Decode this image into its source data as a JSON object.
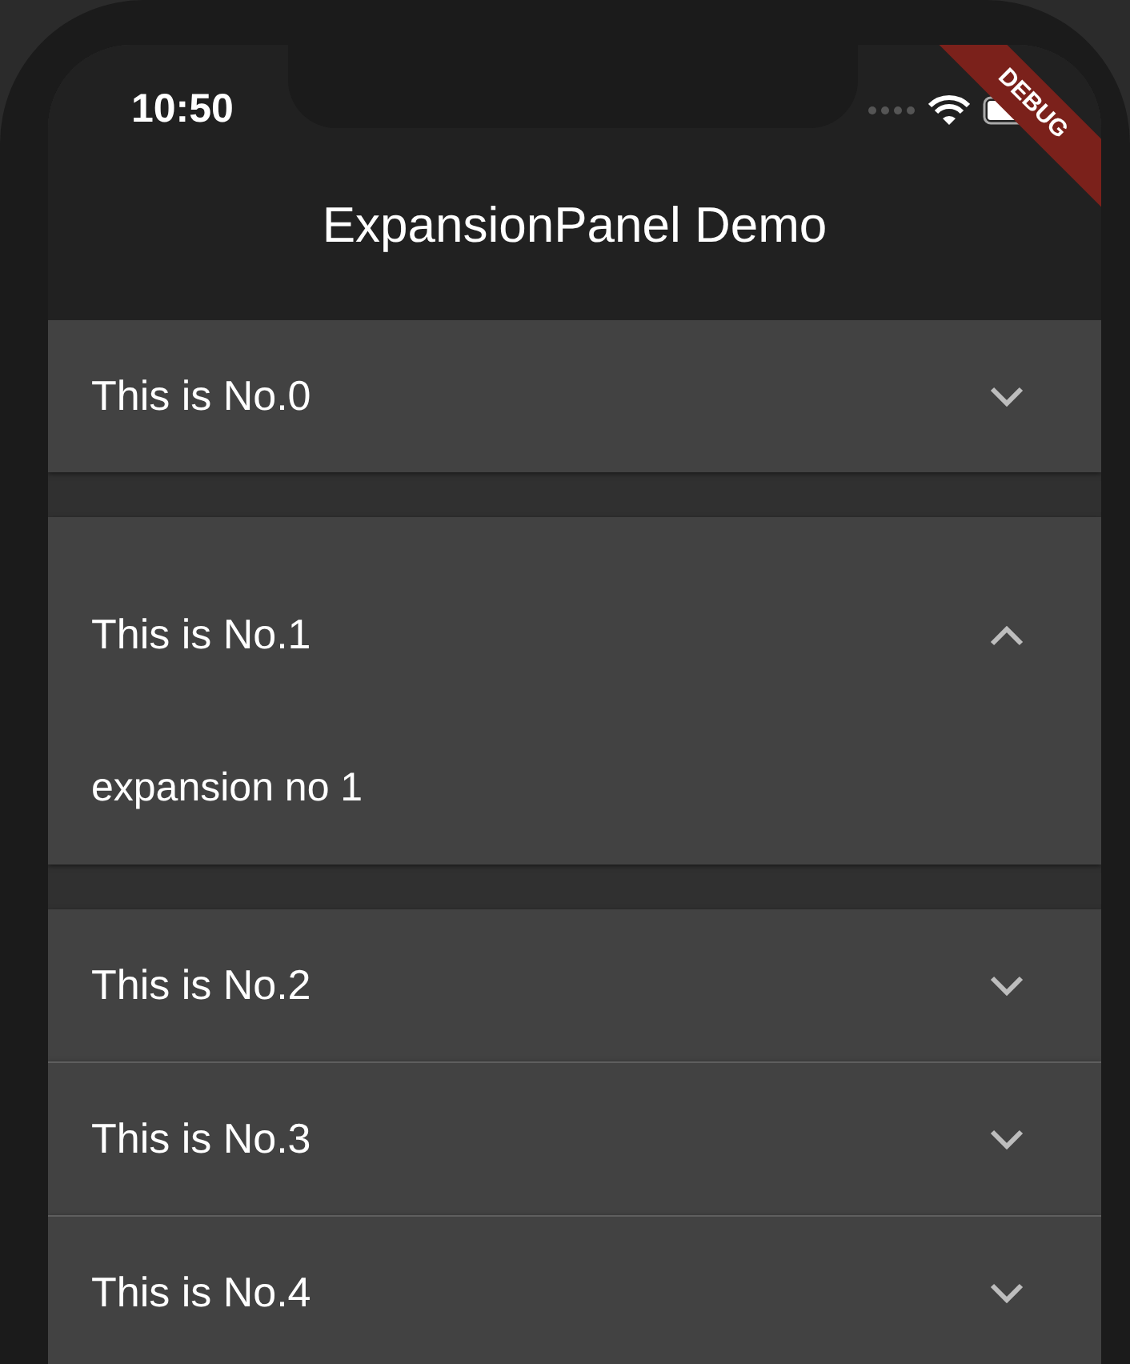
{
  "status_bar": {
    "time": "10:50"
  },
  "debug_banner": "DEBUG",
  "app_bar": {
    "title": "ExpansionPanel Demo"
  },
  "panels": [
    {
      "title": "This is No.0",
      "expanded": false
    },
    {
      "title": "This is No.1",
      "expanded": true,
      "body": "expansion no 1"
    },
    {
      "title": "This is No.2",
      "expanded": false
    },
    {
      "title": "This is No.3",
      "expanded": false
    },
    {
      "title": "This is No.4",
      "expanded": false
    }
  ]
}
